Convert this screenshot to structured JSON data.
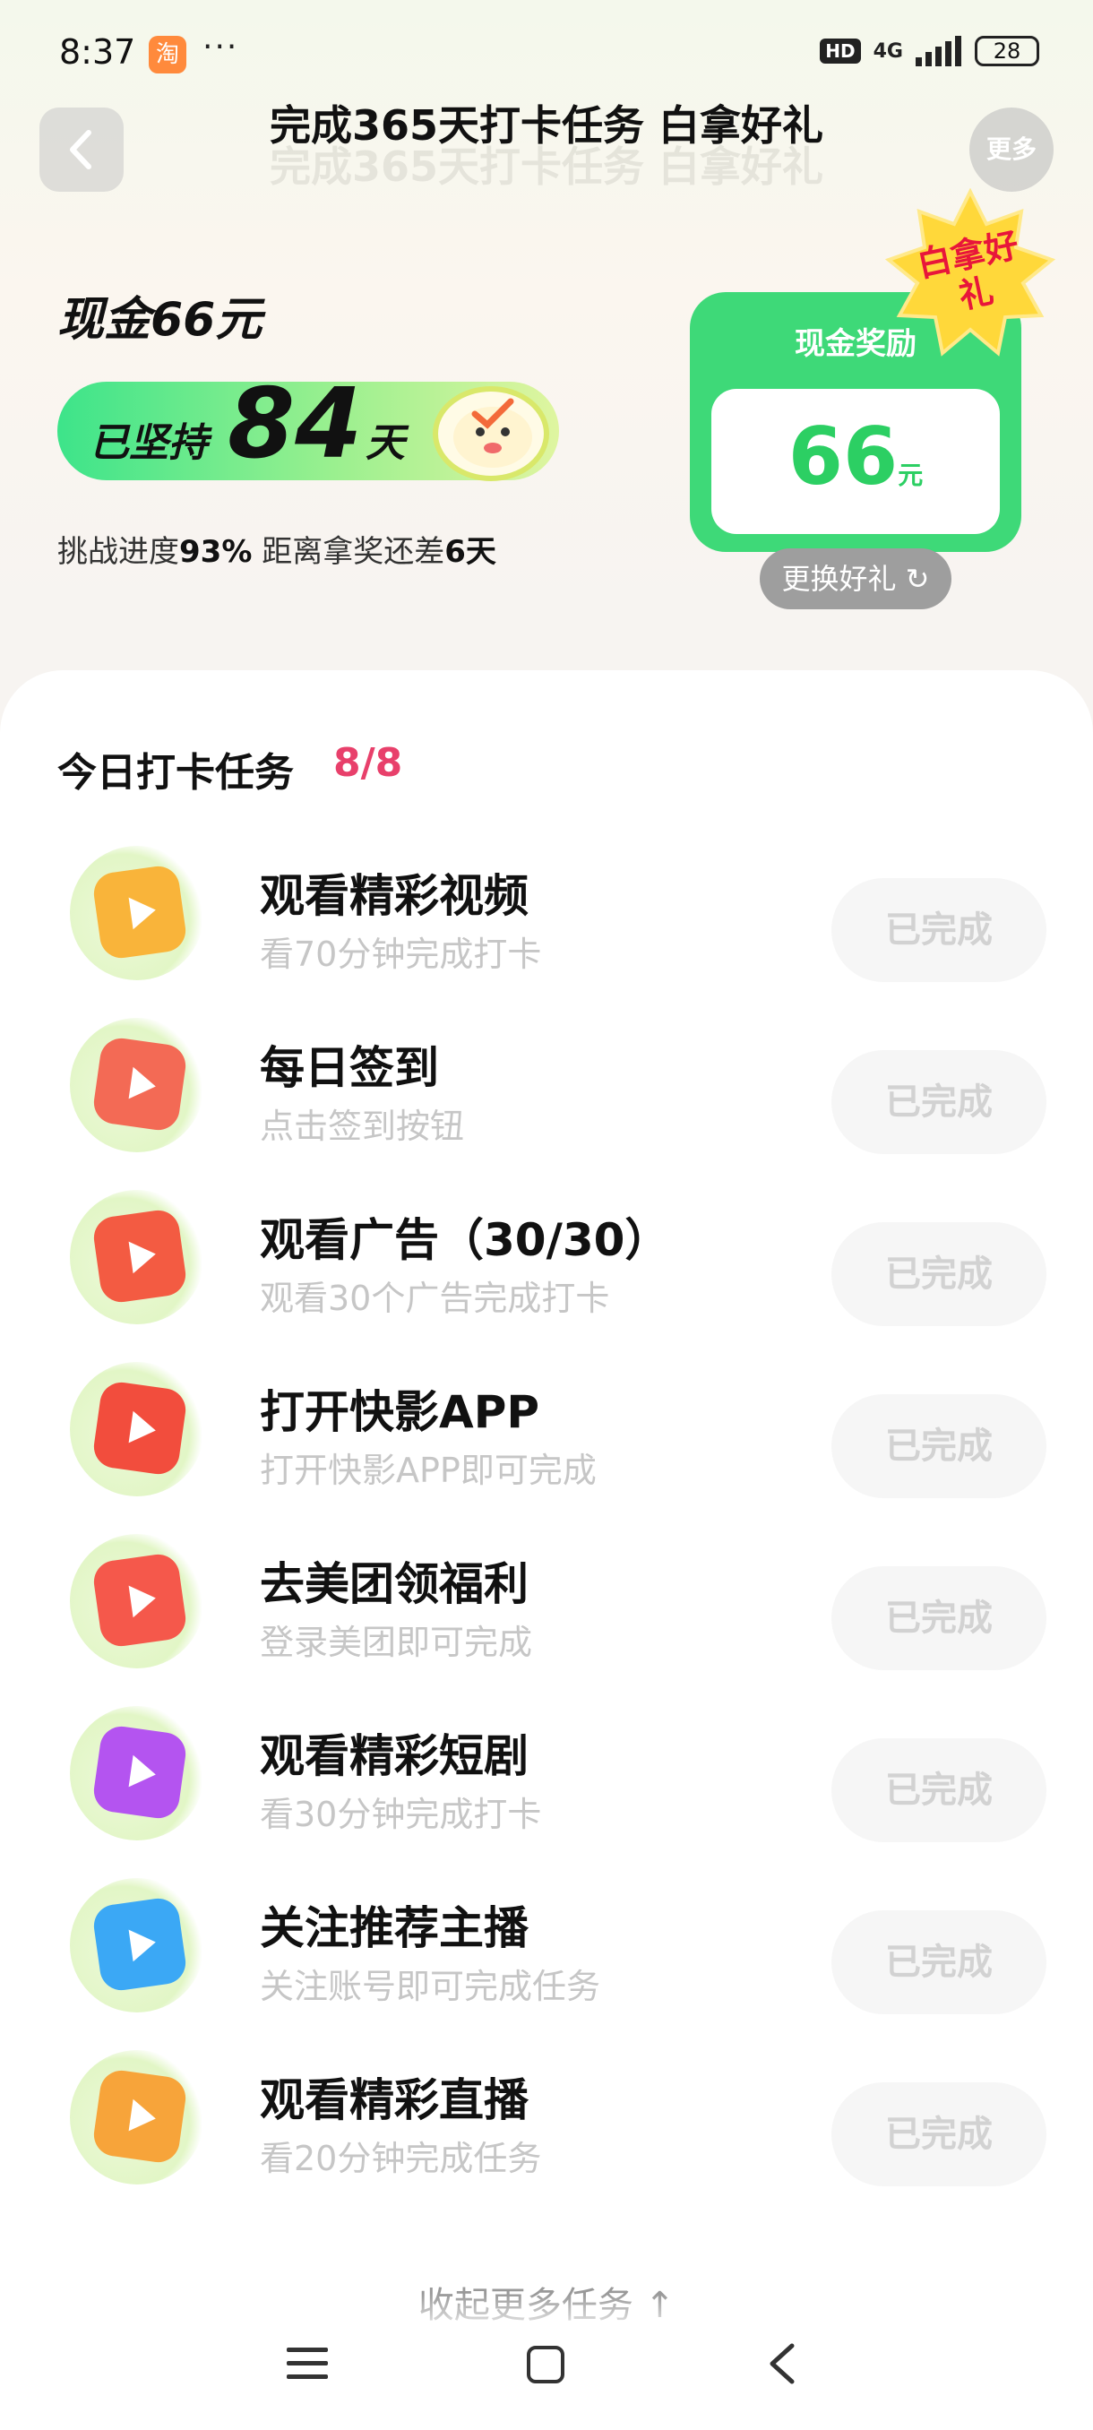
{
  "status_bar": {
    "time": "8:37",
    "app_icon": "taobao-app-icon",
    "dots": "···",
    "hd": "HD",
    "network": "4G",
    "battery": "28"
  },
  "header": {
    "title": "完成365天打卡任务 白拿好礼",
    "more_label": "更多"
  },
  "hero": {
    "cash_title": "现金66元",
    "streak_prefix": "已坚持",
    "streak_days": "84",
    "streak_suffix": "天",
    "progress_prefix": "挑战进度",
    "progress_value": "93%",
    "remaining_prefix": " 距离拿奖还差",
    "remaining_value": "6天",
    "progress_fraction": 0.93
  },
  "reward": {
    "label": "现金奖励",
    "amount": "66",
    "unit": "元",
    "badge": "白拿好礼",
    "change_label": "更换好礼 ↻"
  },
  "tasks_section": {
    "title": "今日打卡任务",
    "count": "8/8",
    "items": [
      {
        "name": "观看精彩视频",
        "desc": "看70分钟完成打卡",
        "button": "已完成",
        "icon": "video-play-icon",
        "color": "#f9b43a"
      },
      {
        "name": "每日签到",
        "desc": "点击签到按钮",
        "button": "已完成",
        "icon": "calendar-check-icon",
        "color": "#f36a55"
      },
      {
        "name": "观看广告（30/30）",
        "desc": "观看30个广告完成打卡",
        "button": "已完成",
        "icon": "ad-play-icon",
        "color": "#f35b42"
      },
      {
        "name": "打开快影APP",
        "desc": "打开快影APP即可完成",
        "button": "已完成",
        "icon": "kuaiying-camera-icon",
        "color": "#f24d3d"
      },
      {
        "name": "去美团领福利",
        "desc": "登录美团即可完成",
        "button": "已完成",
        "icon": "phone-play-icon",
        "color": "#f5584b"
      },
      {
        "name": "观看精彩短剧",
        "desc": "看30分钟完成打卡",
        "button": "已完成",
        "icon": "tv-play-icon",
        "color": "#b454f0"
      },
      {
        "name": "关注推荐主播",
        "desc": "关注账号即可完成任务",
        "button": "已完成",
        "icon": "follow-user-icon",
        "color": "#3ba8f5"
      },
      {
        "name": "观看精彩直播",
        "desc": "看20分钟完成任务",
        "button": "已完成",
        "icon": "live-camera-icon",
        "color": "#f7a43a"
      }
    ],
    "collapse_label": "收起更多任务 ↑"
  },
  "nav": {
    "menu": "menu-icon",
    "home": "home-icon",
    "back": "back-icon"
  }
}
